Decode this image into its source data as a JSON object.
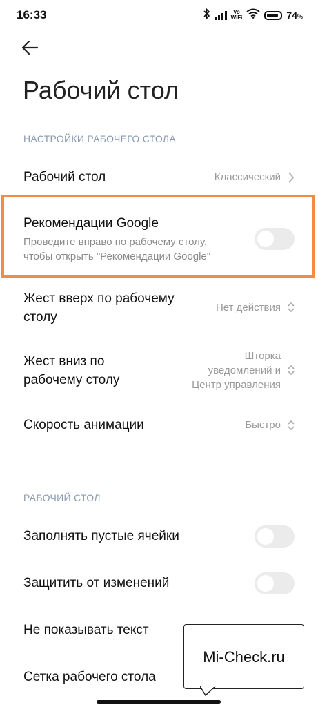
{
  "status_bar": {
    "time": "16:33",
    "vowifi_top": "Vo",
    "vowifi_bottom": "WiFi",
    "battery_value": "74",
    "battery_unit": "%"
  },
  "header": {
    "back_icon": "arrow-left-icon",
    "title": "Рабочий стол"
  },
  "section_desktop_settings": {
    "header": "НАСТРОЙКИ РАБОЧЕГО СТОЛА",
    "items": [
      {
        "title": "Рабочий стол",
        "value": "Классический",
        "control": "chevron-right"
      },
      {
        "title": "Рекомендации Google",
        "description_line1": "Проведите вправо по рабочему столу,",
        "description_line2": "чтобы открыть \"Рекомендации Google\"",
        "control": "toggle",
        "enabled": false,
        "highlighted": true
      },
      {
        "title_line1": "Жест вверх по рабочему",
        "title_line2": "столу",
        "value": "Нет действия",
        "control": "chevron-updown"
      },
      {
        "title_line1": "Жест вниз по",
        "title_line2": "рабочему столу",
        "value_line1": "Шторка",
        "value_line2": "уведомлений и",
        "value_line3": "Центр управления",
        "control": "chevron-updown"
      },
      {
        "title": "Скорость анимации",
        "value": "Быстро",
        "control": "chevron-updown"
      }
    ]
  },
  "section_desktop": {
    "header": "РАБОЧИЙ СТОЛ",
    "items": [
      {
        "title": "Заполнять пустые ячейки",
        "control": "toggle",
        "enabled": false
      },
      {
        "title": "Защитить от изменений",
        "control": "toggle",
        "enabled": false
      },
      {
        "title": "Не показывать текст"
      },
      {
        "title": "Сетка рабочего стола"
      }
    ]
  },
  "watermark": {
    "text": "Mi-Check.ru"
  },
  "colors": {
    "highlight": "#f08c45",
    "section_header": "#8a9bb0",
    "toggle_off": "#ebebeb",
    "secondary_text": "#8a8a8a"
  }
}
